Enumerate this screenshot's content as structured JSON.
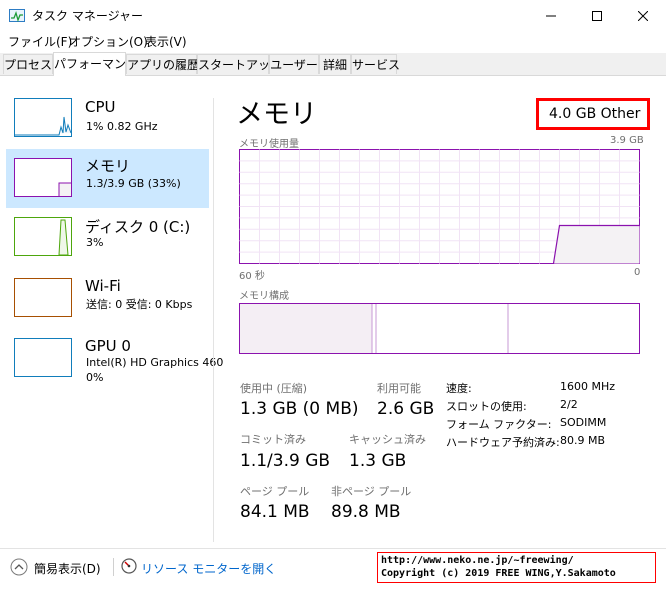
{
  "window": {
    "title": "タスク マネージャー"
  },
  "menu": [
    "ファイル(F)",
    "オプション(O)",
    "表示(V)"
  ],
  "tabs": [
    "プロセス",
    "パフォーマンス",
    "アプリの履歴",
    "スタートアップ",
    "ユーザー",
    "詳細",
    "サービス"
  ],
  "active_tab": "パフォーマンス",
  "sidebar": {
    "items": [
      {
        "title": "CPU",
        "sub": "1% 0.82 GHz",
        "sub2": "",
        "color": "#117dbb",
        "selected": false
      },
      {
        "title": "メモリ",
        "sub": "1.3/3.9 GB (33%)",
        "sub2": "",
        "color": "#8b12ae",
        "selected": true
      },
      {
        "title": "ディスク 0 (C:)",
        "sub": "3%",
        "sub2": "",
        "color": "#4da60c",
        "selected": false
      },
      {
        "title": "Wi-Fi",
        "sub": "送信: 0 受信: 0 Kbps",
        "sub2": "",
        "color": "#a74f01",
        "selected": false
      },
      {
        "title": "GPU 0",
        "sub": "Intel(R) HD Graphics 460",
        "sub2": "0%",
        "color": "#117dbb",
        "selected": false
      }
    ]
  },
  "memory": {
    "title": "メモリ",
    "other_label": "4.0 GB Other",
    "usage_graph": {
      "label": "メモリ使用量",
      "max_label": "3.9 GB",
      "x_left": "60 秒",
      "x_right": "0",
      "ylim": [
        0,
        3.9
      ],
      "recent_usage_gb": 1.3
    },
    "composition": {
      "label": "メモリ構成",
      "in_use_fraction": 0.33,
      "modified_fraction": 0.01,
      "standby_fraction": 0.33,
      "free_fraction": 0.33
    },
    "stats": {
      "in_use_label": "使用中 (圧縮)",
      "in_use_value": "1.3 GB (0 MB)",
      "available_label": "利用可能",
      "available_value": "2.6 GB",
      "committed_label": "コミット済み",
      "committed_value": "1.1/3.9 GB",
      "cached_label": "キャッシュ済み",
      "cached_value": "1.3 GB",
      "paged_label": "ページ プール",
      "paged_value": "84.1 MB",
      "nonpaged_label": "非ページ プール",
      "nonpaged_value": "89.8 MB"
    },
    "details": [
      {
        "label": "速度:",
        "value": "1600 MHz"
      },
      {
        "label": "スロットの使用:",
        "value": "2/2"
      },
      {
        "label": "フォーム ファクター:",
        "value": "SODIMM"
      },
      {
        "label": "ハードウェア予約済み:",
        "value": "80.9 MB"
      }
    ]
  },
  "footer": {
    "fewer_details": "簡易表示(D)",
    "resource_monitor": "リソース モニターを開く",
    "credit_line1": "http://www.neko.ne.jp/~freewing/",
    "credit_line2": "Copyright (c) 2019 FREE WING,Y.Sakamoto"
  },
  "colors": {
    "memory": "#8b12ae",
    "memory_fill": "#f4f2f4",
    "selection": "#cce8ff",
    "highlight_box": "#ff0000",
    "link": "#0066cc"
  }
}
